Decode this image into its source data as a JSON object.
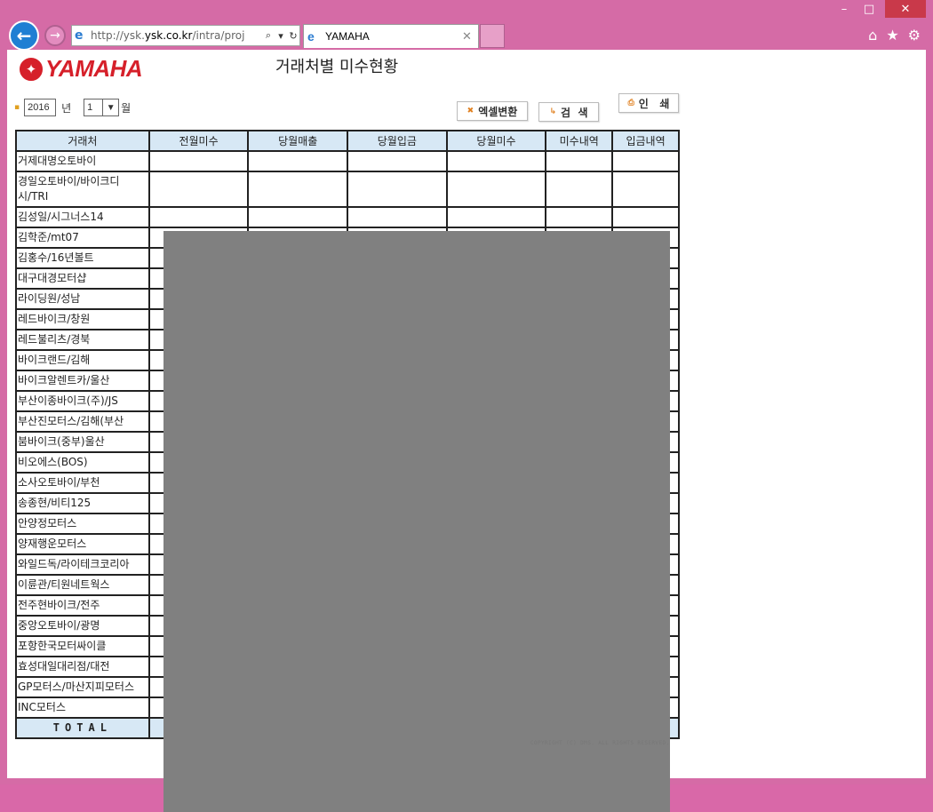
{
  "browser": {
    "url_prefix": "http://ysk.",
    "url_domain": "ysk.co.kr",
    "url_suffix": "/intra/proj",
    "tab_title": "YAMAHA",
    "minimize": "–",
    "maximize": "□",
    "close": "✕",
    "back": "←",
    "forward": "→",
    "search_glyph": "⌕",
    "dropdown_glyph": "▾",
    "refresh_glyph": "↻",
    "tab_close": "✕",
    "home_glyph": "⌂",
    "star_glyph": "★",
    "gear_glyph": "⚙",
    "ie_glyph": "e"
  },
  "logo": {
    "text": "YAMAHA",
    "emblem": "✦"
  },
  "page": {
    "title": "거래처별 미수현황"
  },
  "filter": {
    "bullet": "▪",
    "year": "2016",
    "year_label": "년",
    "month": "1",
    "month_arrow": "▼",
    "month_label": "월"
  },
  "buttons": {
    "excel_icon": "✖",
    "excel": "엑셀변환",
    "search_icon": "↳",
    "search": "검  색",
    "print_icon": "⎙",
    "print": "인   쇄"
  },
  "table": {
    "headers": [
      "거래처",
      "전월미수",
      "당월매출",
      "당월입금",
      "당월미수",
      "미수내역",
      "입금내역"
    ],
    "rows": [
      "거제대명오토바이",
      "경일오토바이/바이크디시/TRI",
      "김성일/시그너스14",
      "김학준/mt07",
      "김홍수/16년볼트",
      "대구대경모터샵",
      "라이딩원/성남",
      "레드바이크/창원",
      "레드불리츠/경북",
      "바이크랜드/김해",
      "바이크알렌트카/울산",
      "부산이종바이크(주)/JS",
      "부산진모터스/김해(부산",
      "붐바이크(중부)울산",
      "비오에스(BOS)",
      "소사오토바이/부천",
      "송종현/비티125",
      "안양정모터스",
      "양재행운모터스",
      "와일드독/라이테크코리아",
      "이륜관/티원네트웍스",
      "전주현바이크/전주",
      "중앙오토바이/광명",
      "포항한국모터싸이클",
      "효성대일대리점/대전",
      "GP모터스/마산지피모터스",
      "INC모터스"
    ],
    "total_label": "TOTAL"
  },
  "footer": {
    "copyright": "COPYRIGHT (C) DMS. ALL RIGHTS RESERVED."
  }
}
